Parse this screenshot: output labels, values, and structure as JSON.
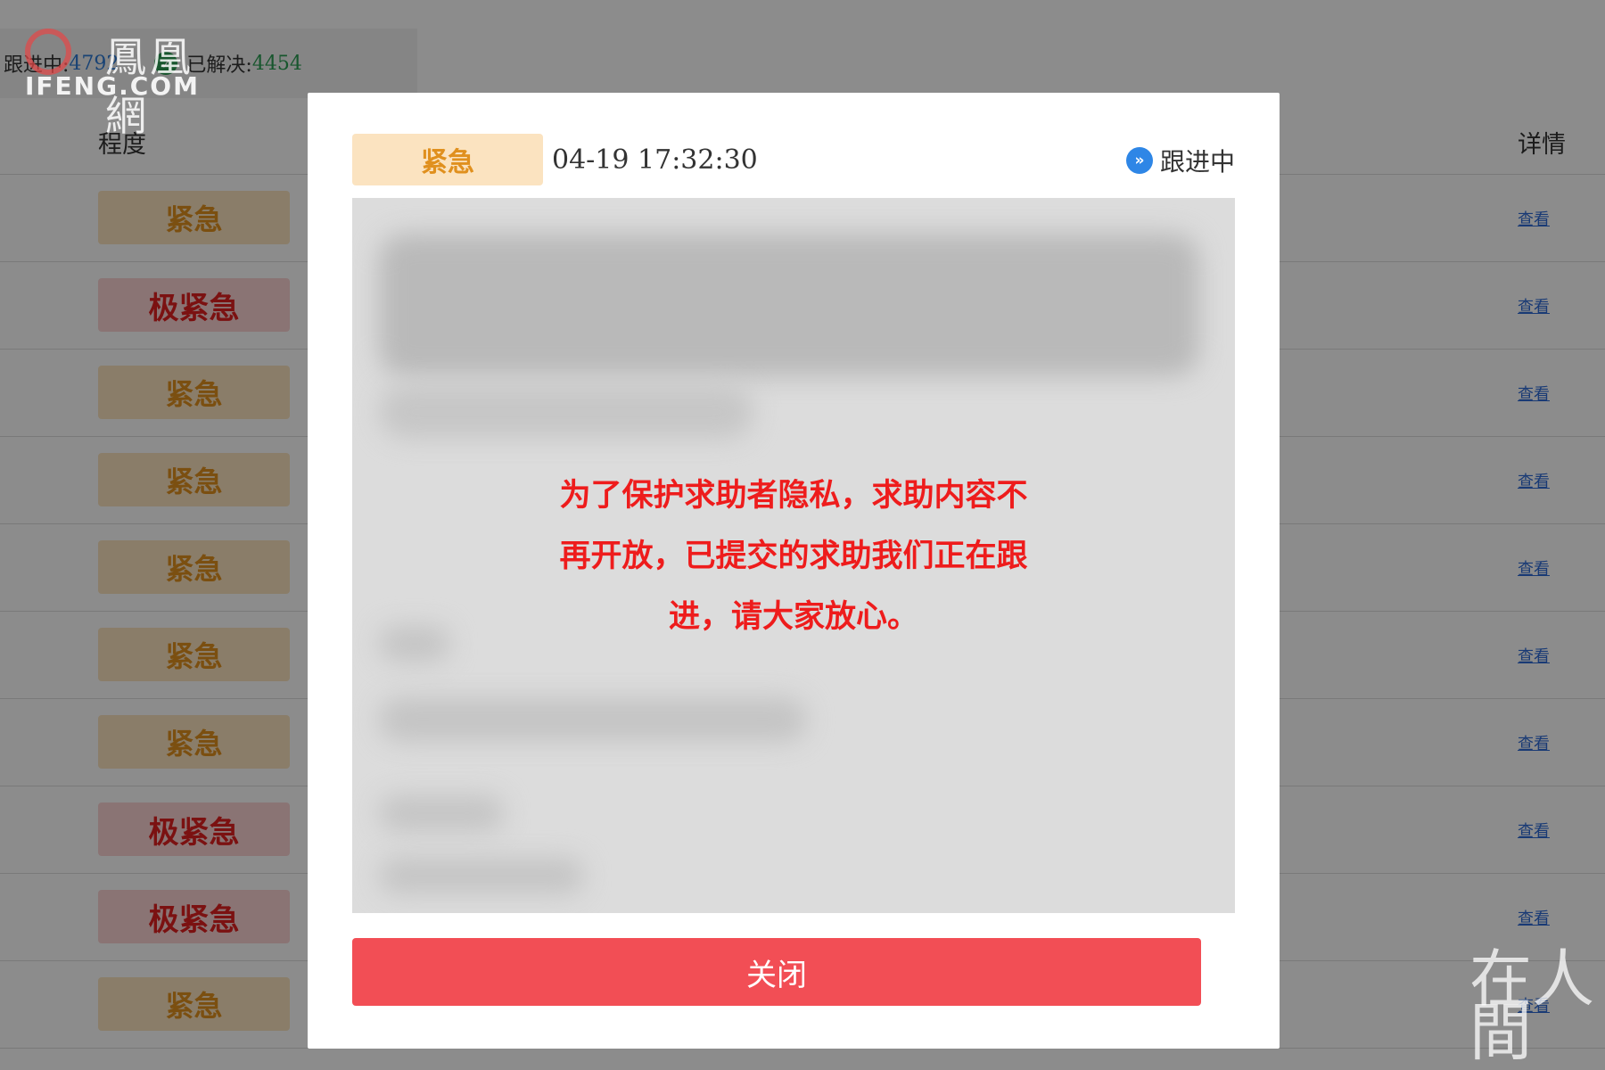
{
  "stats": {
    "tracking_label": "跟进中:",
    "tracking_count": "4792",
    "solved_label": "已解决:",
    "solved_count": "4454",
    "check_icon": "check-circle-icon"
  },
  "watermark": {
    "logo_cn": "鳳凰網",
    "logo_en": "IFENG.COM",
    "corner_text": "在人間"
  },
  "table": {
    "col_degree": "程度",
    "col_detail": "详情",
    "rows": [
      {
        "level": "紧急",
        "kind": "urgent",
        "link": "查看"
      },
      {
        "level": "极紧急",
        "kind": "extreme",
        "link": "查看"
      },
      {
        "level": "紧急",
        "kind": "urgent",
        "link": "查看"
      },
      {
        "level": "紧急",
        "kind": "urgent",
        "link": "查看"
      },
      {
        "level": "紧急",
        "kind": "urgent",
        "link": "查看"
      },
      {
        "level": "紧急",
        "kind": "urgent",
        "link": "查看"
      },
      {
        "level": "紧急",
        "kind": "urgent",
        "link": "查看"
      },
      {
        "level": "极紧急",
        "kind": "extreme",
        "link": "查看"
      },
      {
        "level": "极紧急",
        "kind": "extreme",
        "link": "查看"
      },
      {
        "level": "紧急",
        "kind": "urgent",
        "link": "查看"
      }
    ]
  },
  "modal": {
    "badge": "紧急",
    "time": "04-19 17:32:30",
    "status": "跟进中",
    "status_icon": "double-chevron-right-icon",
    "notice_line1": "为了保护求助者隐私，求助内容不",
    "notice_line2": "再开放，已提交的求助我们正在跟",
    "notice_line3": "进，请大家放心。",
    "close_label": "关闭"
  },
  "colors": {
    "urgent_bg": "#fbe3c0",
    "urgent_text": "#e0901e",
    "extreme_bg": "#fbd3d3",
    "extreme_text": "#e02020",
    "close_button": "#f24e55",
    "notice_text": "#ee1c1c",
    "link": "#2e6bd6"
  }
}
